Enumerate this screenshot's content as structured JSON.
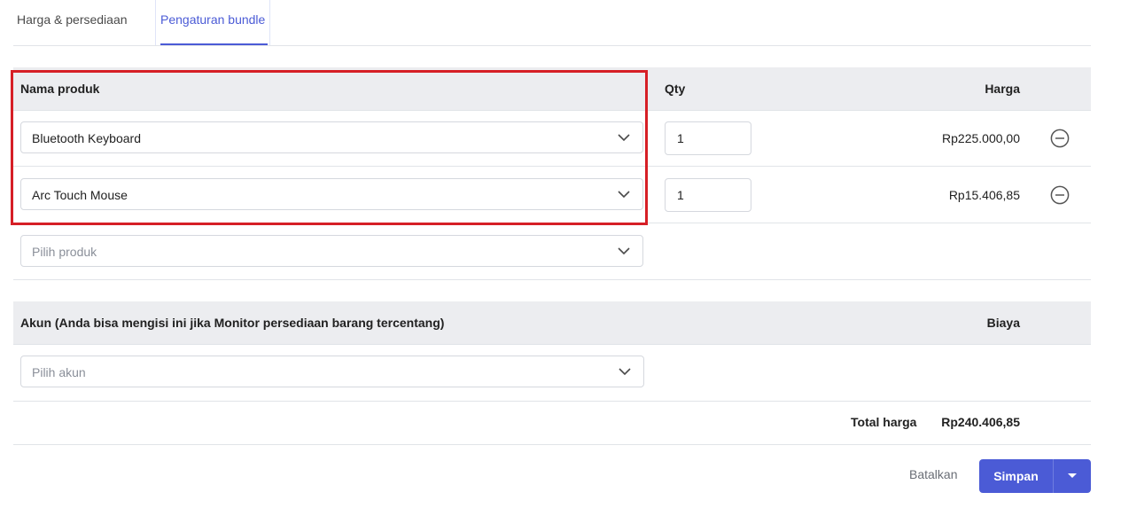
{
  "tabs": [
    {
      "label": "Harga & persediaan",
      "active": false
    },
    {
      "label": "Pengaturan bundle",
      "active": true
    }
  ],
  "products_table": {
    "headers": {
      "name": "Nama produk",
      "qty": "Qty",
      "price": "Harga"
    },
    "rows": [
      {
        "product": "Bluetooth Keyboard",
        "qty": "1",
        "price": "Rp225.000,00"
      },
      {
        "product": "Arc Touch Mouse",
        "qty": "1",
        "price": "Rp15.406,85"
      }
    ],
    "add_placeholder": "Pilih produk"
  },
  "account_table": {
    "headers": {
      "account": "Akun (Anda bisa mengisi ini jika Monitor persediaan barang tercentang)",
      "cost": "Biaya"
    },
    "placeholder": "Pilih akun"
  },
  "total": {
    "label": "Total harga",
    "value": "Rp240.406,85"
  },
  "actions": {
    "cancel": "Batalkan",
    "save": "Simpan"
  },
  "colors": {
    "accent": "#4b5bd6",
    "highlight": "#d61f26",
    "header_bg": "#ecedf0"
  },
  "icons": {
    "dropdown": "chevron-down-icon",
    "remove": "minus-circle-icon",
    "save_menu": "caret-down-icon"
  }
}
